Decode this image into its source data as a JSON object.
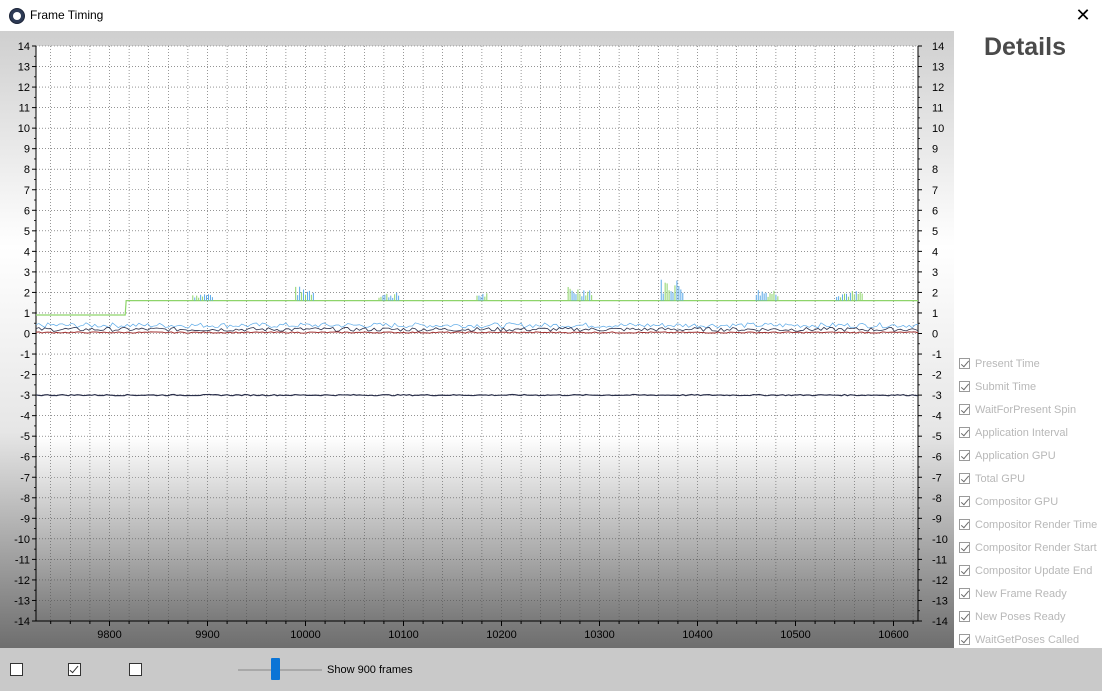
{
  "window": {
    "title": "Frame Timing",
    "close_glyph": "✕"
  },
  "details": {
    "title": "Details",
    "legend": [
      {
        "label": "Present Time",
        "checked": true
      },
      {
        "label": "Submit Time",
        "checked": true
      },
      {
        "label": "WaitForPresent Spin",
        "checked": true
      },
      {
        "label": "Application Interval",
        "checked": true
      },
      {
        "label": "Application GPU",
        "checked": true
      },
      {
        "label": "Total GPU",
        "checked": true
      },
      {
        "label": "Compositor GPU",
        "checked": true
      },
      {
        "label": "Compositor Render Time",
        "checked": true
      },
      {
        "label": "Compositor Render Start",
        "checked": true
      },
      {
        "label": "Compositor Update End",
        "checked": true
      },
      {
        "label": "New Frame Ready",
        "checked": true
      },
      {
        "label": "New Poses Ready",
        "checked": true
      },
      {
        "label": "WaitGetPoses Called",
        "checked": true
      }
    ]
  },
  "bottom": {
    "checkboxes": [
      {
        "checked": false
      },
      {
        "checked": true
      },
      {
        "checked": false
      }
    ],
    "frames_label": "Show 900 frames",
    "slider_fraction": 0.4
  },
  "colors": {
    "series_green": "#8ed46a",
    "series_blue": "#5aa9e8",
    "series_dark": "#2a2f4a",
    "series_red": "#a03030"
  },
  "chart_data": {
    "type": "line",
    "xlim": [
      9725,
      10625
    ],
    "ylim": [
      -14,
      14
    ],
    "x_ticks": [
      9800,
      9900,
      10000,
      10100,
      10200,
      10300,
      10400,
      10500,
      10600
    ],
    "y_ticks": [
      14,
      13,
      12,
      11,
      10,
      9,
      8,
      7,
      6,
      5,
      4,
      3,
      2,
      1,
      0,
      -1,
      -2,
      -3,
      -4,
      -5,
      -6,
      -7,
      -8,
      -9,
      -10,
      -11,
      -12,
      -13,
      -14
    ],
    "grid": true,
    "series": [
      {
        "x": [
          9725,
          9816,
          9817,
          10625
        ],
        "values": [
          0.9,
          0.9,
          1.6,
          1.6
        ]
      },
      {
        "x": [
          9725,
          10625
        ],
        "values": [
          0.4,
          0.4
        ]
      },
      {
        "x": [
          9725,
          10625
        ],
        "values": [
          0.2,
          0.2
        ]
      },
      {
        "x": [
          9725,
          10625
        ],
        "values": [
          0.05,
          0.05
        ]
      },
      {
        "x": [
          9725,
          10625
        ],
        "values": [
          -3.0,
          -3.0
        ]
      }
    ],
    "spikes": [
      {
        "start": 9885,
        "end": 9905,
        "peak": 2.0
      },
      {
        "start": 9990,
        "end": 10008,
        "peak": 2.3
      },
      {
        "start": 10075,
        "end": 10095,
        "peak": 2.0
      },
      {
        "start": 10175,
        "end": 10185,
        "peak": 2.0
      },
      {
        "start": 10268,
        "end": 10292,
        "peak": 2.3
      },
      {
        "start": 10363,
        "end": 10385,
        "peak": 2.7
      },
      {
        "start": 10460,
        "end": 10482,
        "peak": 2.2
      },
      {
        "start": 10542,
        "end": 10568,
        "peak": 2.1
      }
    ]
  }
}
